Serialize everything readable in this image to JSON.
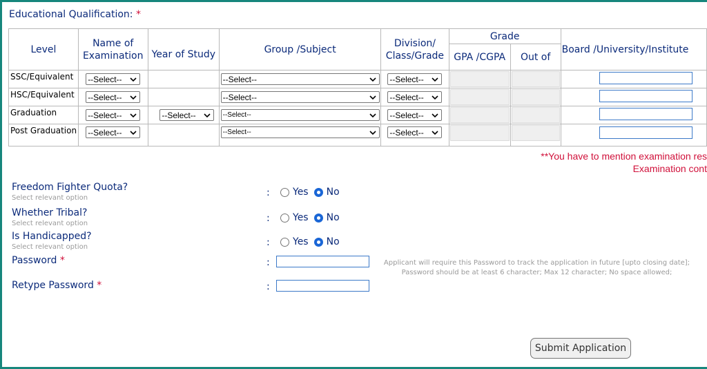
{
  "section": {
    "title": "Educational Qualification:",
    "required_mark": "*"
  },
  "table": {
    "headers": {
      "level": "Level",
      "name_of_examination": "Name of Examination",
      "year_of_study": "Year of Study",
      "group_subject": "Group /Subject",
      "division": "Division/ Class/Grade",
      "grade": "Grade",
      "gpa": "GPA /CGPA",
      "out_of": "Out of",
      "board": "Board /University/Institute"
    },
    "rows": [
      {
        "level": "SSC/Equivalent",
        "exam": "--Select--",
        "year": "",
        "subject": "--Select--",
        "division": "--Select--"
      },
      {
        "level": "HSC/Equivalent",
        "exam": "--Select--",
        "year": "",
        "subject": "--Select--",
        "division": "--Select--"
      },
      {
        "level": "Graduation",
        "exam": "--Select--",
        "year": "--Select--",
        "subject": "--Select--",
        "division": "--Select--"
      },
      {
        "level": "Post Graduation",
        "exam": "--Select--",
        "year": "",
        "subject": "--Select--",
        "division": "--Select--"
      }
    ]
  },
  "note": {
    "line1": "**You have to mention examination res",
    "line2": "Examination cont"
  },
  "questions": [
    {
      "label": "Freedom Fighter Quota?",
      "hint": "Select relevant option",
      "yes": "Yes",
      "no": "No",
      "selected": "No"
    },
    {
      "label": "Whether Tribal?",
      "hint": "Select relevant option",
      "yes": "Yes",
      "no": "No",
      "selected": "No"
    },
    {
      "label": "Is Handicapped?",
      "hint": "Select relevant option",
      "yes": "Yes",
      "no": "No",
      "selected": "No"
    }
  ],
  "colon": ":",
  "password": {
    "label": "Password",
    "retype_label": "Retype Password",
    "required_mark": "*",
    "value": "",
    "retype_value": "",
    "hint_line1": "Applicant will require this Password to track the application in future [upto closing date];",
    "hint_line2": "Password should be at least 6 character; Max 12 character; No space allowed;"
  },
  "submit_label": "Submit Application",
  "colors": {
    "frame": "#17867c",
    "label": "#0b2a7a",
    "required": "#d0103a",
    "radio_selected": "#1a66d6"
  }
}
